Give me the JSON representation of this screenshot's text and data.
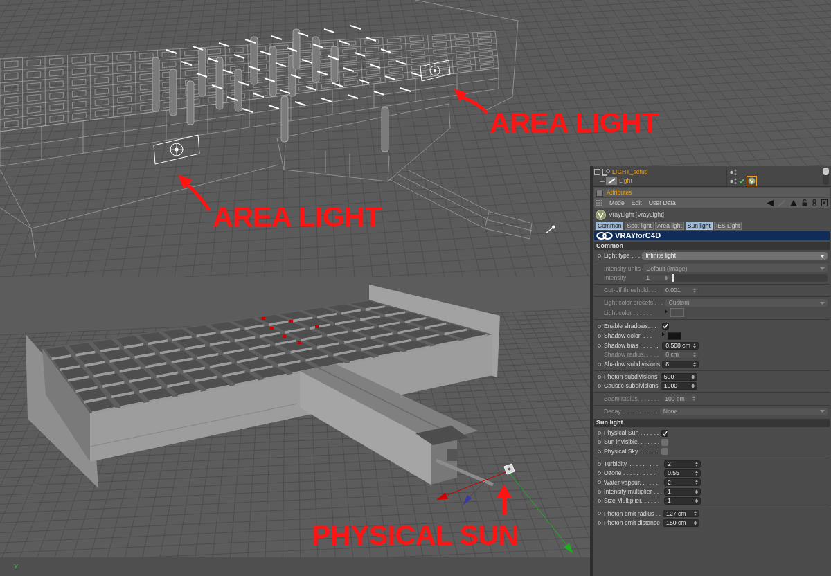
{
  "top_viewport": {
    "annotations": [
      {
        "text": "AREA LIGHT"
      },
      {
        "text": "AREA LIGHT"
      }
    ]
  },
  "bottom_viewport": {
    "annotation": "PHYSICAL SUN",
    "axis_label": "Y"
  },
  "object_manager": {
    "rows": [
      {
        "name": "LIGHT_setup",
        "kind": "null",
        "expanded": true,
        "children": [
          {
            "name": "Light",
            "kind": "light",
            "tag": {
              "selected": true
            }
          }
        ]
      }
    ]
  },
  "attributes": {
    "title": "Attributes",
    "menu": [
      "Mode",
      "Edit",
      "User Data"
    ],
    "object": "VrayLight [VrayLight]",
    "tabs": [
      {
        "label": "Common",
        "selected": true
      },
      {
        "label": "Spot light",
        "selected": false
      },
      {
        "label": "Area light",
        "selected": false
      },
      {
        "label": "Sun light",
        "selected": true
      },
      {
        "label": "IES Light",
        "selected": false
      }
    ],
    "banner": "**VRAY**for**C4D**",
    "sections": [
      {
        "title": "Common",
        "groups": [
          [
            {
              "kind": "dropdown",
              "label": "Light type . . .",
              "value": "Infinite light",
              "disabled": false
            }
          ],
          [
            {
              "kind": "dropdown",
              "label": "Intensity units",
              "value": "Default (image)",
              "disabled": true
            },
            {
              "kind": "slider",
              "label": "Intensity",
              "value": "1",
              "level": 0,
              "disabled": true
            }
          ],
          [
            {
              "kind": "number",
              "label": "Cut-off threshold. . . .",
              "value": "0.001",
              "disabled": true
            }
          ],
          [
            {
              "kind": "dropdown",
              "label": "Light color presets . . .",
              "value": "Custom",
              "disabled": true
            },
            {
              "kind": "color",
              "label": "Light color . . . . . .",
              "color": "#4e4e4e",
              "disabled": true
            }
          ],
          [
            {
              "kind": "checkbox",
              "label": "Enable shadows. . . .",
              "checked": true,
              "disabled": false
            },
            {
              "kind": "color",
              "label": "Shadow color. . . .",
              "color": "#141414",
              "disabled": false
            },
            {
              "kind": "number",
              "label": "Shadow bias . . . . . .",
              "value": "0.508 cm",
              "disabled": false
            },
            {
              "kind": "number",
              "label": "Shadow radius. . . . .",
              "value": "0 cm",
              "disabled": true
            },
            {
              "kind": "number",
              "label": "Shadow subdivisions",
              "value": "8",
              "disabled": false
            }
          ],
          [
            {
              "kind": "number",
              "label": "Photon subdivisions",
              "value": "500",
              "disabled": false
            },
            {
              "kind": "number",
              "label": "Caustic subdivisions",
              "value": "1000",
              "disabled": false
            }
          ],
          [
            {
              "kind": "number",
              "label": "Beam radius. . . . . . .",
              "value": "100 cm",
              "disabled": true
            }
          ],
          [
            {
              "kind": "dropdown",
              "label": "Decay . . . . . . . . . . .",
              "value": "None",
              "disabled": true
            }
          ]
        ]
      },
      {
        "title": "Sun light",
        "groups": [
          [
            {
              "kind": "checkbox",
              "label": "Physical Sun . . . . . .",
              "checked": true,
              "disabled": false
            },
            {
              "kind": "checkbox",
              "label": "Sun invisible. . . . . . .",
              "checked": false,
              "disabled": false
            },
            {
              "kind": "checkbox",
              "label": "Physical Sky. . . . . . .",
              "checked": false,
              "disabled": false
            }
          ],
          [
            {
              "kind": "number",
              "label": "Turbidity. . . . . . . . . .",
              "value": "2",
              "disabled": false
            },
            {
              "kind": "number",
              "label": "Ozone . . . . . . . . . .",
              "value": "0.55",
              "disabled": false
            },
            {
              "kind": "number",
              "label": "Water vapour. . . . . .",
              "value": "2",
              "disabled": false
            },
            {
              "kind": "number",
              "label": "Intensity multiplier . . .",
              "value": "1",
              "disabled": false
            },
            {
              "kind": "number",
              "label": "Size Multiplier. . . . . .",
              "value": "1",
              "disabled": false
            }
          ],
          [
            {
              "kind": "number",
              "label": "Photon emit radius . .",
              "value": "127 cm",
              "disabled": false
            },
            {
              "kind": "number",
              "label": "Photon emit distance",
              "value": "150 cm",
              "disabled": false
            }
          ]
        ]
      }
    ]
  }
}
